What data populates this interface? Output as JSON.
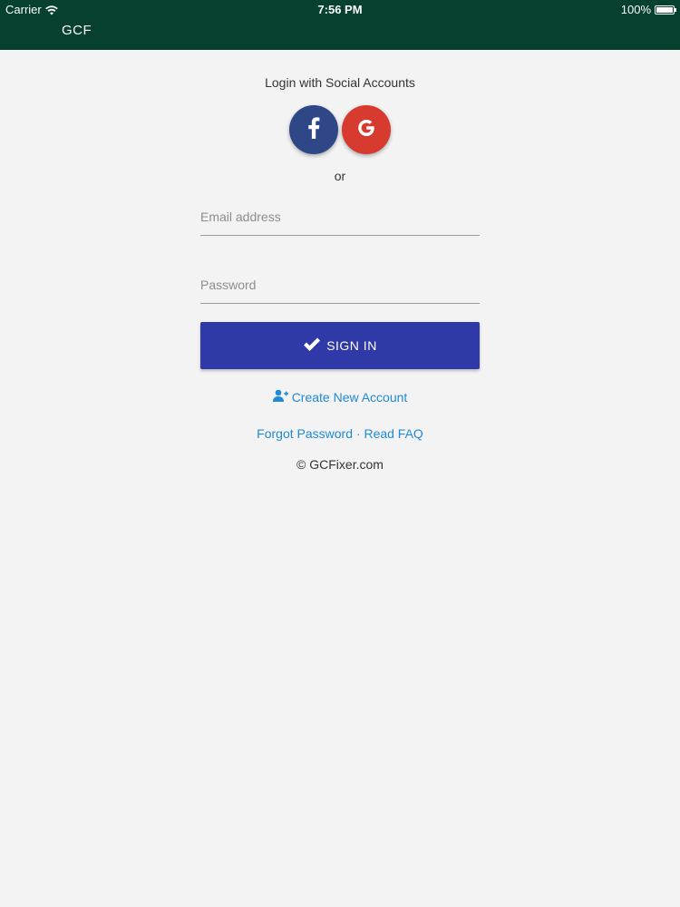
{
  "status_bar": {
    "carrier": "Carrier",
    "time": "7:56 PM",
    "battery": "100%",
    "wifi_icon": "wifi-icon",
    "battery_icon": "battery-icon"
  },
  "header": {
    "title": "GCF",
    "background_color": "#06402f"
  },
  "social": {
    "heading": "Login with Social Accounts",
    "facebook_icon": "facebook-icon",
    "facebook_color": "#2f4687",
    "google_icon": "google-icon",
    "google_color": "#d73a2f",
    "or_label": "or"
  },
  "form": {
    "email_placeholder": "Email address",
    "email_value": "",
    "password_placeholder": "Password",
    "password_value": "",
    "signin_label": "SIGN IN",
    "signin_icon": "checkmark-icon",
    "signin_color": "#3039a8"
  },
  "links": {
    "create_account_icon": "add-user-icon",
    "create_account": "Create New Account",
    "forgot_password": "Forgot Password",
    "separator": " · ",
    "read_faq": "Read FAQ",
    "link_color": "#1f8ad6"
  },
  "footer": {
    "copyright": "© GCFixer.com"
  }
}
